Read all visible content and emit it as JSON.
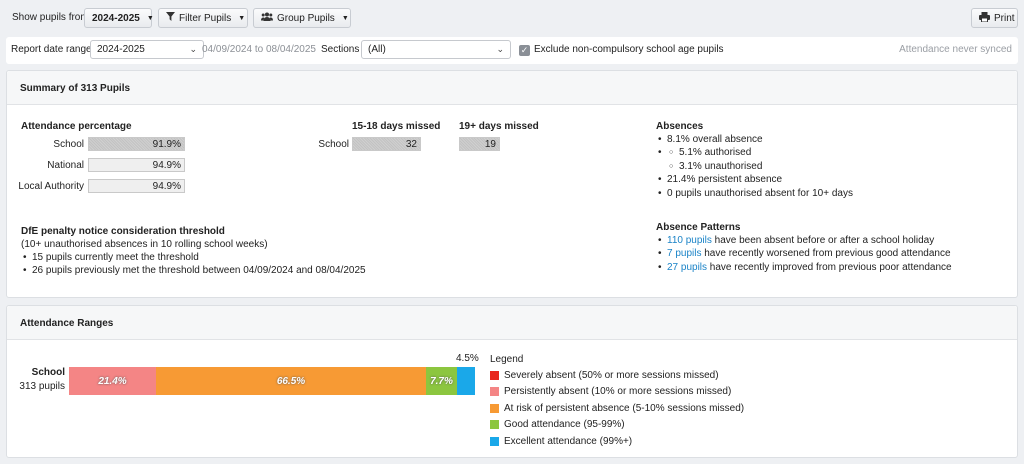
{
  "toolbar": {
    "show_pupils_from_label": "Show pupils from",
    "year_selected": "2024-2025",
    "filter_label": "Filter Pupils",
    "group_label": "Group Pupils",
    "print_label": "Print"
  },
  "filters": {
    "report_date_range_label": "Report date range",
    "report_year": "2024-2025",
    "date_span": "04/09/2024 to 08/04/2025",
    "sections_label": "Sections",
    "sections_value": "(All)",
    "exclude_label": "Exclude non-compulsory school age pupils",
    "exclude_checked": true,
    "sync_status": "Attendance never synced"
  },
  "summary": {
    "title": "Summary of 313 Pupils",
    "attendance": {
      "heading": "Attendance percentage",
      "rows": [
        {
          "label": "School",
          "value": "91.9%",
          "pct": 91.9,
          "highlight": true
        },
        {
          "label": "National",
          "value": "94.9%",
          "pct": 94.9,
          "highlight": false
        },
        {
          "label": "Local Authority",
          "value": "94.9%",
          "pct": 94.9,
          "highlight": false
        }
      ]
    },
    "days_missed": {
      "row_label": "School",
      "col1_heading": "15-18 days missed",
      "col1_value": "32",
      "col2_heading": "19+ days missed",
      "col2_value": "19"
    },
    "absences": {
      "heading": "Absences",
      "overall": "8.1% overall absence",
      "authorised": "5.1% authorised",
      "unauthorised": "3.1% unauthorised",
      "persistent": "21.4% persistent absence",
      "pupils_unauth": "0 pupils unauthorised absent for 10+ days"
    },
    "dfe": {
      "heading": "DfE penalty notice consideration threshold",
      "subheading": "(10+ unauthorised absences in 10 rolling school weeks)",
      "item1": "15 pupils currently meet the threshold",
      "item2": "26 pupils previously met the threshold between 04/09/2024 and 08/04/2025"
    },
    "patterns": {
      "heading": "Absence Patterns",
      "items": [
        {
          "link": "110 pupils",
          "text": " have been absent before or after a school holiday"
        },
        {
          "link": "7 pupils",
          "text": " have recently worsened from previous good attendance"
        },
        {
          "link": "27 pupils",
          "text": " have recently improved from previous poor attendance"
        }
      ]
    }
  },
  "ranges": {
    "title": "Attendance Ranges",
    "row_label": "School",
    "row_sub": "313 pupils",
    "segments": [
      {
        "label": "21.4%",
        "pct": 21.4,
        "color": "#f48585"
      },
      {
        "label": "66.5%",
        "pct": 66.5,
        "color": "#f79a34"
      },
      {
        "label": "7.7%",
        "pct": 7.7,
        "color": "#8cc63f"
      },
      {
        "label": "4.5%",
        "pct": 4.5,
        "color": "#1aa8e9"
      }
    ],
    "legend_title": "Legend",
    "legend": [
      {
        "label": "Severely absent (50% or more sessions missed)",
        "color": "#e8261c"
      },
      {
        "label": "Persistently absent (10% or more sessions missed)",
        "color": "#f48585"
      },
      {
        "label": "At risk of persistent absence (5-10% sessions missed)",
        "color": "#f79a34"
      },
      {
        "label": "Good attendance (95-99%)",
        "color": "#8cc63f"
      },
      {
        "label": "Excellent attendance (99%+)",
        "color": "#1aa8e9"
      }
    ]
  }
}
